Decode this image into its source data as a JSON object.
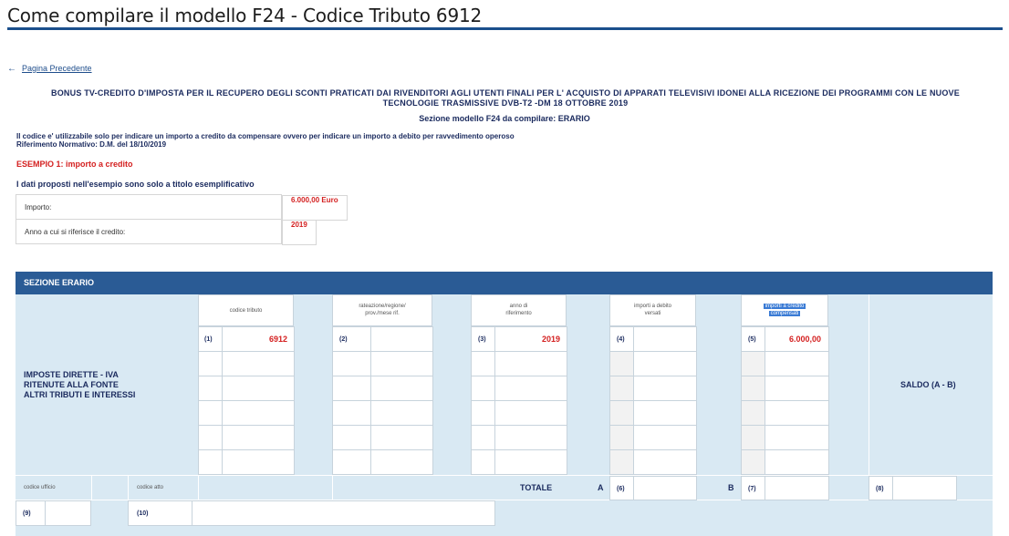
{
  "page": {
    "title": "Come compilare il modello F24 - Codice Tributo 6912",
    "back_link": "Pagina Precedente",
    "heading_line1": "BONUS TV-CREDITO D'IMPOSTA PER IL RECUPERO DEGLI SCONTI PRATICATI DAI RIVENDITORI AGLI UTENTI FINALI PER L' ACQUISTO DI APPARATI TELEVISIVI IDONEI ALLA RICEZIONE DEI PROGRAMMI CON LE NUOVE",
    "heading_line2": "TECNOLOGIE TRASMISSIVE DVB-T2 -DM 18 OTTOBRE 2019",
    "sezione": "Sezione modello F24 da compilare: ERARIO",
    "note_line1": "Il codice e' utilizzabile solo per indicare un importo a credito da compensare ovvero per indicare un importo a debito per ravvedimento operoso",
    "note_line2": "Riferimento Normativo: D.M.  del 18/10/2019",
    "esempio": "ESEMPIO 1: importo a credito",
    "dati_note": "I dati proposti nell'esempio sono solo a titolo esemplificativo"
  },
  "info_table": [
    {
      "label": "Importo:",
      "value": "6.000,00 Euro"
    },
    {
      "label": "Anno a cui si riferisce il credito:",
      "value": "2019"
    }
  ],
  "f24": {
    "section_title": "SEZIONE ERARIO",
    "col_headers": {
      "codice_tributo": "codice tributo",
      "rateazione_1": "rateazione/regione/",
      "rateazione_2": "prov./mese rif.",
      "anno_1": "anno di",
      "anno_2": "riferimento",
      "debito_1": "importi a debito",
      "debito_2": "versati",
      "credito_1": "importi a credito",
      "credito_2": "compensati"
    },
    "row_label_1": "IMPOSTE DIRETTE - IVA",
    "row_label_2": "RITENUTE ALLA FONTE",
    "row_label_3": "ALTRI TRIBUTI E INTERESSI",
    "saldo": "SALDO (A - B)",
    "field_numbers": {
      "n1": "(1)",
      "n2": "(2)",
      "n3": "(3)",
      "n4": "(4)",
      "n5": "(5)",
      "n6": "(6)",
      "n7": "(7)",
      "n8": "(8)",
      "n9": "(9)",
      "n10": "(10)"
    },
    "values": {
      "codice_tributo": "6912",
      "anno": "2019",
      "importo_credito": "6.000,00"
    },
    "codice_ufficio": "codice ufficio",
    "codice_atto": "codice atto",
    "totale": "TOTALE",
    "a": "A",
    "b": "B"
  }
}
